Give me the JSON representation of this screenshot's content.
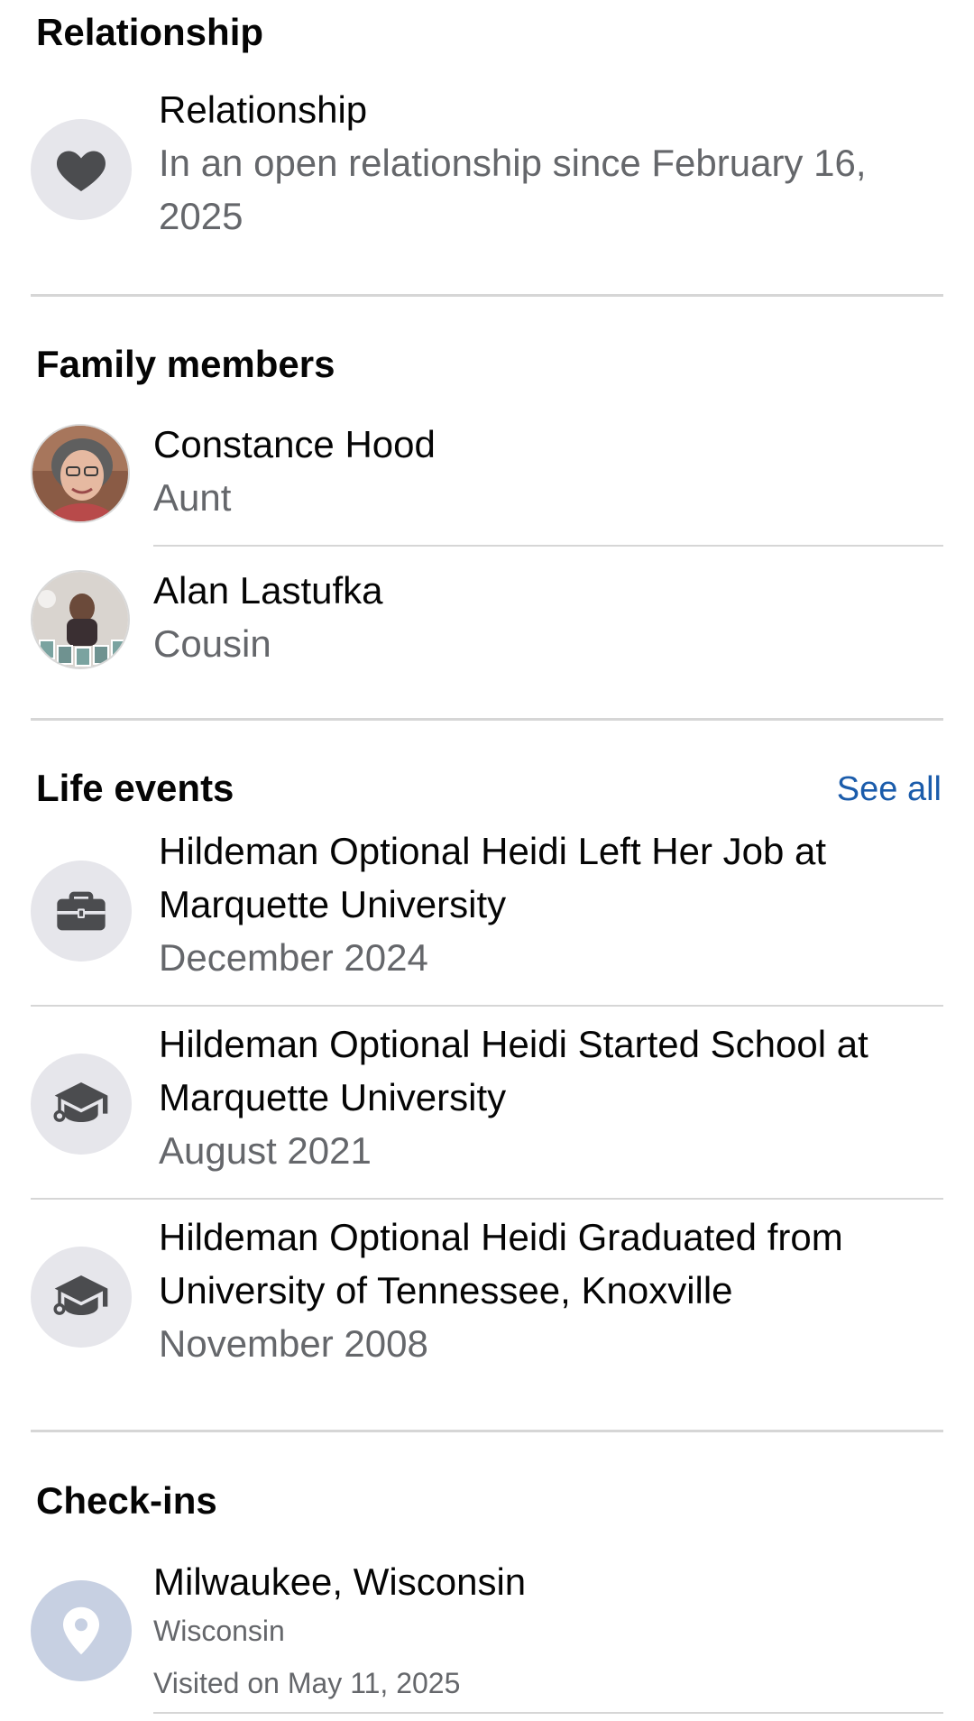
{
  "relationship": {
    "section_title": "Relationship",
    "label": "Relationship",
    "status_line1": "In an open relationship since February 16,",
    "status_line2": "2025"
  },
  "family": {
    "section_title": "Family members",
    "members": [
      {
        "name": "Constance Hood",
        "relation": "Aunt"
      },
      {
        "name": "Alan Lastufka",
        "relation": "Cousin"
      }
    ]
  },
  "life_events": {
    "section_title": "Life events",
    "see_all": "See all",
    "events": [
      {
        "line1": "Hildeman Optional Heidi Left Her Job at",
        "line2": "Marquette University",
        "date": "December 2024",
        "icon": "briefcase-icon"
      },
      {
        "line1": "Hildeman Optional Heidi Started School at",
        "line2": "Marquette University",
        "date": "August 2021",
        "icon": "graduation-cap-icon"
      },
      {
        "line1": "Hildeman Optional Heidi Graduated from",
        "line2": "University of Tennessee, Knoxville",
        "date": "November 2008",
        "icon": "graduation-cap-icon"
      }
    ]
  },
  "checkins": {
    "section_title": "Check-ins",
    "items": [
      {
        "place": "Milwaukee, Wisconsin",
        "region": "Wisconsin",
        "visited": "Visited on May 11, 2025",
        "icon": "map-pin-icon"
      }
    ]
  },
  "colors": {
    "link": "#1b5cab",
    "secondary_text": "#65676b",
    "icon_bg": "#e6e6eb",
    "icon_fg": "#4b4c4f",
    "pin_bg": "#c7d0e2"
  }
}
